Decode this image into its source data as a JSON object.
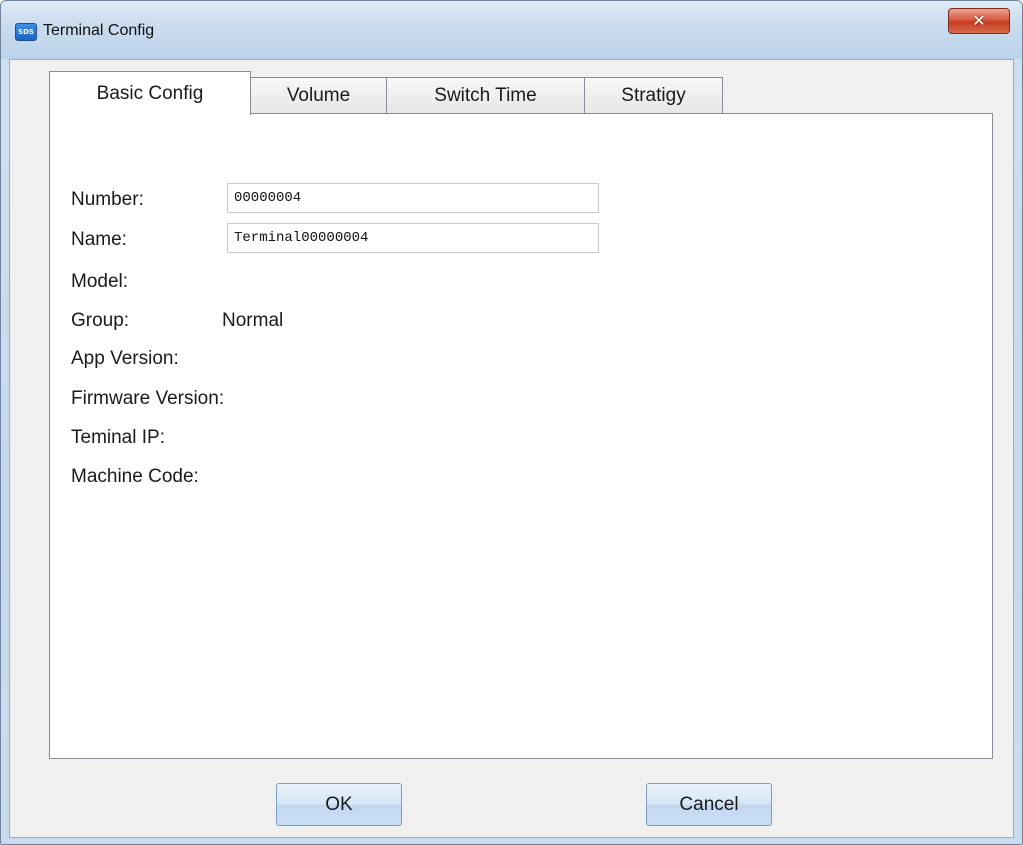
{
  "window": {
    "title": "Terminal Config",
    "app_icon_text": "SDS",
    "close_symbol": "✕"
  },
  "tabs": [
    {
      "label": "Basic Config",
      "selected": true
    },
    {
      "label": "Volume",
      "selected": false
    },
    {
      "label": "Switch Time",
      "selected": false
    },
    {
      "label": "Stratigy",
      "selected": false
    }
  ],
  "basic_config": {
    "number_label": "Number:",
    "number_value": "00000004",
    "name_label": "Name:",
    "name_value": "Terminal00000004",
    "model_label": "Model:",
    "group_label": "Group:",
    "group_value": "Normal",
    "app_version_label": "App Version:",
    "firmware_version_label": "Firmware Version:",
    "terminal_ip_label": "Teminal IP:",
    "machine_code_label": "Machine Code:"
  },
  "buttons": {
    "ok_label": "OK",
    "cancel_label": "Cancel"
  },
  "icons": {
    "app_icon": "app-logo-icon",
    "close_icon": "close-icon"
  },
  "colors": {
    "close_button": "#c53d20",
    "button_border": "#7a9ec6",
    "title_bar": "#c9dbee"
  }
}
